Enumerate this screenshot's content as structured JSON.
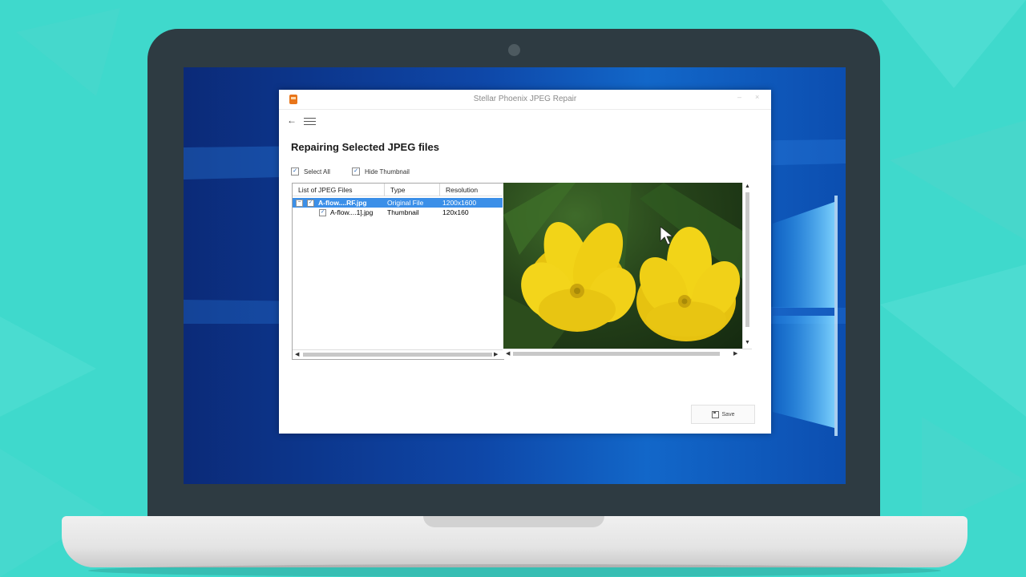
{
  "colors": {
    "background": "#3fd9cc",
    "laptop_bezel": "#2e3b42",
    "selection": "#3b8fe8",
    "app_icon": "#e8751a"
  },
  "window": {
    "title": "Stellar Phoenix JPEG Repair",
    "minimize_icon": "–",
    "close_icon": "×"
  },
  "toolbar": {
    "back_icon": "back-arrow-icon",
    "menu_icon": "hamburger-menu-icon"
  },
  "main": {
    "heading": "Repairing Selected JPEG files",
    "select_all_label": "Select All",
    "select_all_checked": true,
    "hide_thumbnail_label": "Hide Thumbnail",
    "hide_thumbnail_checked": true
  },
  "file_list": {
    "columns": [
      "List of JPEG Files",
      "Type",
      "Resolution"
    ],
    "rows": [
      {
        "name": "A-flow....RF.jpg",
        "type": "Original File",
        "resolution": "1200x1600",
        "selected": true,
        "expanded": true,
        "checked": true
      },
      {
        "name": "A-flow....1].jpg",
        "type": "Thumbnail",
        "resolution": "120x160",
        "selected": false,
        "checked": true
      }
    ]
  },
  "preview": {
    "image_description_icon": "tulip-image"
  },
  "save_button": {
    "label": "Save"
  }
}
